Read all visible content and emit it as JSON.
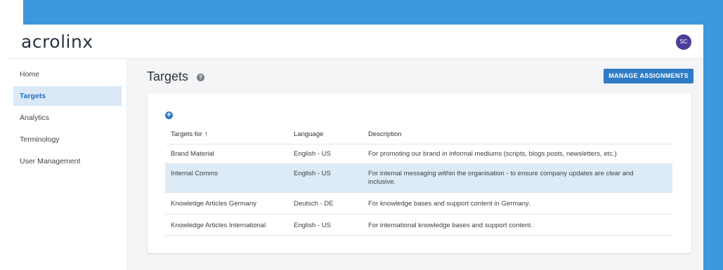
{
  "app": {
    "logo": "acrolinx",
    "avatar": "SC"
  },
  "sidebar": {
    "items": [
      {
        "label": "Home"
      },
      {
        "label": "Targets"
      },
      {
        "label": "Analytics"
      },
      {
        "label": "Terminology"
      },
      {
        "label": "User Management"
      }
    ]
  },
  "main": {
    "title": "Targets",
    "help_icon": "help-icon",
    "manage_label": "MANAGE ASSIGNMENTS",
    "add_icon": "plus-circle-icon"
  },
  "table": {
    "headers": [
      "Targets for",
      "Language",
      "Description"
    ],
    "sort_indicator": "↑",
    "rows": [
      {
        "target": "Brand Material",
        "language": "English - US",
        "description": "For promoting our brand in informal mediums (scripts, blogs posts, newsletters, etc.)"
      },
      {
        "target": "Internal Comms",
        "language": "English - US",
        "description": "For internal messaging within the organisation - to ensure company updates are clear and inclusive."
      },
      {
        "target": "Knowledge Articles Germany",
        "language": "Deutsch - DE",
        "description": "For knowledge bases and support content in Germany."
      },
      {
        "target": "Knowledge Articles International",
        "language": "English - US",
        "description": "For international knowledge bases and support content."
      }
    ]
  },
  "colors": {
    "accent": "#2e7bc6",
    "background_frame": "#3d97dd",
    "avatar": "#4b3d9a",
    "selected_row": "#ddebf7"
  }
}
